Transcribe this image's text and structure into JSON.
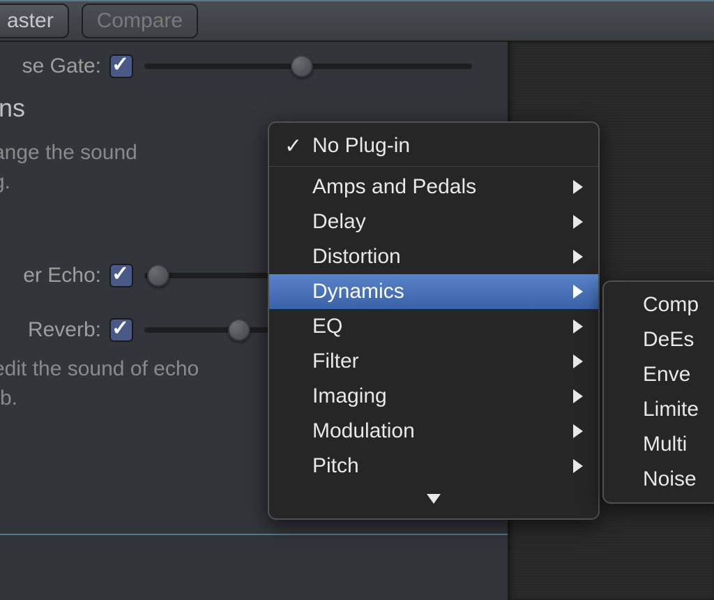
{
  "toolbar": {
    "master_label": "aster",
    "compare_label": "Compare"
  },
  "rows": {
    "gate_label": "se Gate:",
    "echo_label": "er Echo:",
    "reverb_label": "Reverb:"
  },
  "slider_positions": {
    "gate": 210,
    "echo": 4,
    "reverb": 120
  },
  "section": {
    "title_fragment": "ins",
    "desc1_line1": "ange the sound",
    "desc1_line2": "g.",
    "desc2_line1": "edit the sound of echo",
    "desc2_line2": "rb."
  },
  "menu": {
    "no_plugin": "No Plug-in",
    "items": [
      {
        "label": "Amps and Pedals"
      },
      {
        "label": "Delay"
      },
      {
        "label": "Distortion"
      },
      {
        "label": "Dynamics",
        "selected": true
      },
      {
        "label": "EQ"
      },
      {
        "label": "Filter"
      },
      {
        "label": "Imaging"
      },
      {
        "label": "Modulation"
      },
      {
        "label": "Pitch"
      }
    ]
  },
  "submenu": {
    "items": [
      {
        "label": "Comp"
      },
      {
        "label": "DeEs"
      },
      {
        "label": "Enve"
      },
      {
        "label": "Limite"
      },
      {
        "label": "Multi"
      },
      {
        "label": "Noise"
      }
    ]
  }
}
